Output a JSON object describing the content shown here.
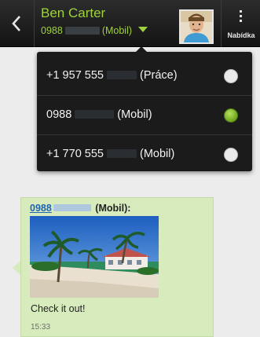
{
  "header": {
    "back_icon": "chevron-left-icon",
    "contact_name": "Ben Carter",
    "contact_number_prefix": "0988",
    "contact_number_type": "(Mobil)",
    "dropdown_icon": "caret-down-icon",
    "menu_icon": "overflow-menu-icon",
    "menu_label": "Nabídka",
    "accent_color": "#9fd23d"
  },
  "number_picker": {
    "items": [
      {
        "number_prefix": "+1 957 555",
        "type": "(Práce)",
        "selected": false
      },
      {
        "number_prefix": "0988",
        "type": "(Mobil)",
        "selected": true
      },
      {
        "number_prefix": "+1 770 555",
        "type": "(Mobil)",
        "selected": false
      }
    ]
  },
  "conversation": {
    "message": {
      "sender_number_prefix": "0988",
      "sender_type": "(Mobil):",
      "image": "beach-photo",
      "text": "Check it out!",
      "time": "15:33"
    }
  }
}
